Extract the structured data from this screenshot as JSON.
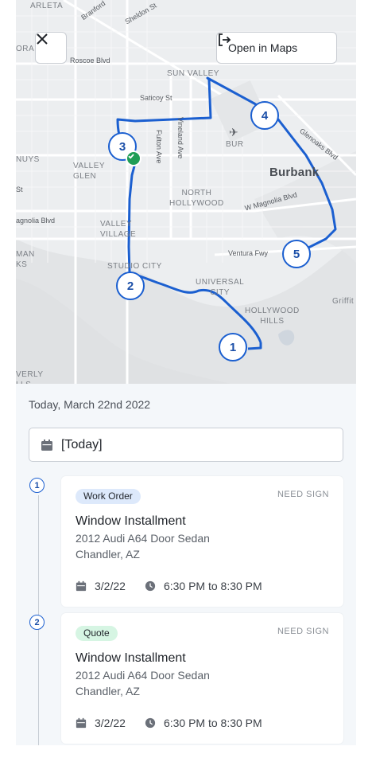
{
  "map": {
    "labels": {
      "arleta": "ARLETA",
      "branford": "Branford",
      "sheldon": "Sheldon St",
      "ora": "ORA",
      "roscoe": "Roscoe Blvd",
      "sun_valley": "SUN VALLEY",
      "saticoy": "Saticoy St",
      "bur": "BUR",
      "glenoaks": "Glenoaks Blvd",
      "nuys": "NUYS",
      "valley_glen": "VALLEY\nGLEN",
      "fulton": "Fulton Ave",
      "vineland": "Vineland Ave",
      "burbank": "Burbank",
      "st": "St",
      "north_hollywood": "NORTH\nHOLLYWOOD",
      "magnolia_w": "W Magnolia Blvd",
      "magnolia": "agnolia Blvd",
      "valley_village": "VALLEY\nVILLAGE",
      "man": "MAN\nKS",
      "ventura": "Ventura Fwy",
      "studio_city": "STUDIO CITY",
      "universal_city": "UNIVERSAL\nCITY",
      "hollywood_hills": "HOLLYWOOD\nHILLS",
      "griffith": "Griffit",
      "verly": "VERLY\nLLS"
    },
    "markers": [
      "1",
      "2",
      "3",
      "4",
      "5"
    ],
    "route_color": "#1b5fd0",
    "check_color": "#1f9d55"
  },
  "header": {
    "open_maps_label": "Open in Maps",
    "open_maps_icon": "external-link-icon",
    "close_icon": "close-icon"
  },
  "schedule": {
    "date_heading": "Today, March 22nd 2022",
    "date_select_value": "[Today]",
    "date_select_icon": "calendar-icon"
  },
  "jobs": [
    {
      "step": "1",
      "badge": "Work Order",
      "badge_color": "#dde9fb",
      "status": "NEED SIGN",
      "title": "Window Installment",
      "vehicle": "2012 Audi A64 Door Sedan",
      "location": "Chandler, AZ",
      "date": "3/2/22",
      "time": "6:30 PM to 8:30 PM"
    },
    {
      "step": "2",
      "badge": "Quote",
      "badge_color": "#d6f5e3",
      "status": "NEED SIGN",
      "title": "Window Installment",
      "vehicle": "2012 Audi A64 Door Sedan",
      "location": "Chandler, AZ",
      "date": "3/2/22",
      "time": "6:30 PM to 8:30 PM"
    }
  ]
}
